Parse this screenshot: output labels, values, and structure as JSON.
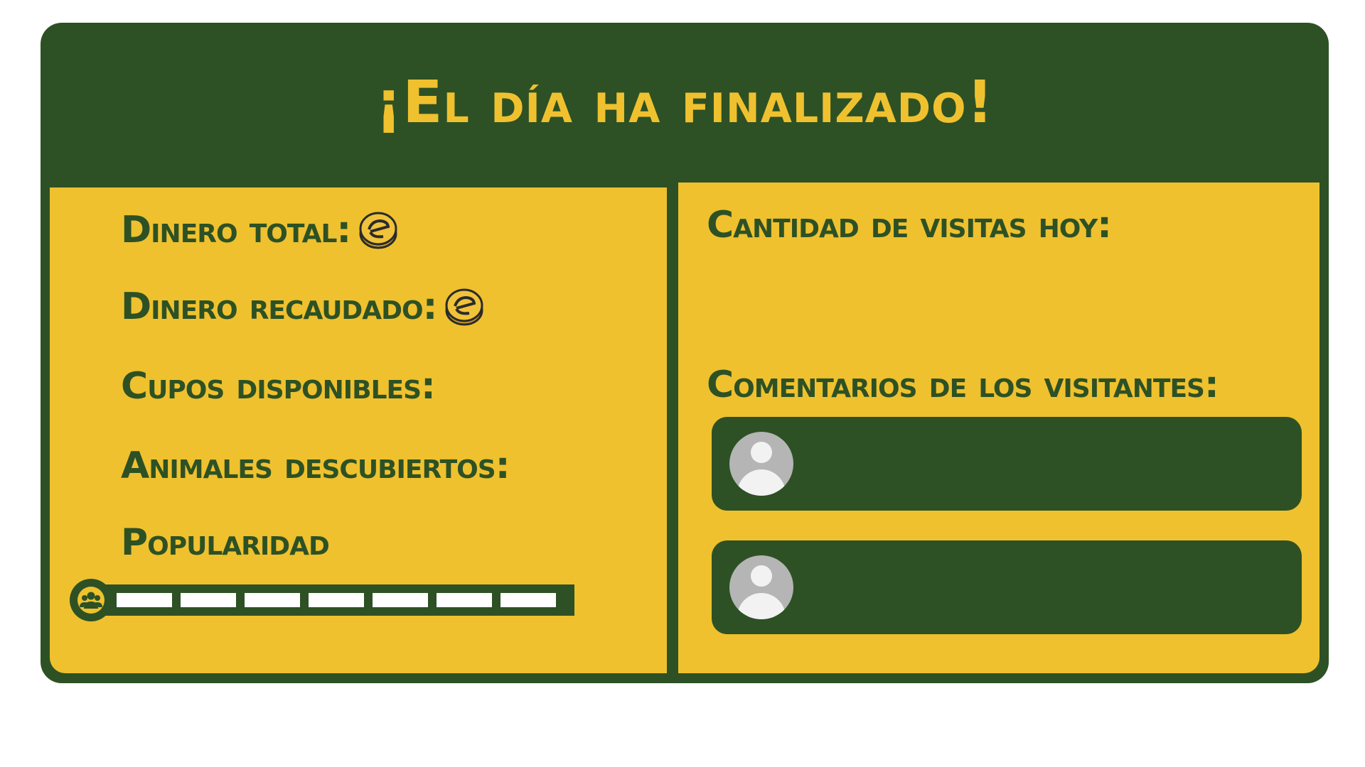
{
  "title": "¡El día ha finalizado!",
  "stats": {
    "total_money_label": "Dinero total:",
    "collected_money_label": "Dinero recaudado:",
    "available_slots_label": "Cupos disponibles:",
    "discovered_animals_label": "Animales descubiertos:",
    "popularity_label": "Popularidad"
  },
  "popularity": {
    "segments": 7,
    "icon": "people-icon"
  },
  "visits": {
    "label": "Cantidad de visitas hoy:"
  },
  "comments": {
    "label": "Comentarios de los visitantes:",
    "items": [
      {
        "avatar": "user-avatar-icon"
      },
      {
        "avatar": "user-avatar-icon"
      }
    ]
  },
  "colors": {
    "dark_green": "#2d5124",
    "yellow": "#efc12f",
    "white": "#ffffff",
    "avatar_gray": "#b5b5b5"
  },
  "icons": {
    "coin": "coin-icon"
  }
}
